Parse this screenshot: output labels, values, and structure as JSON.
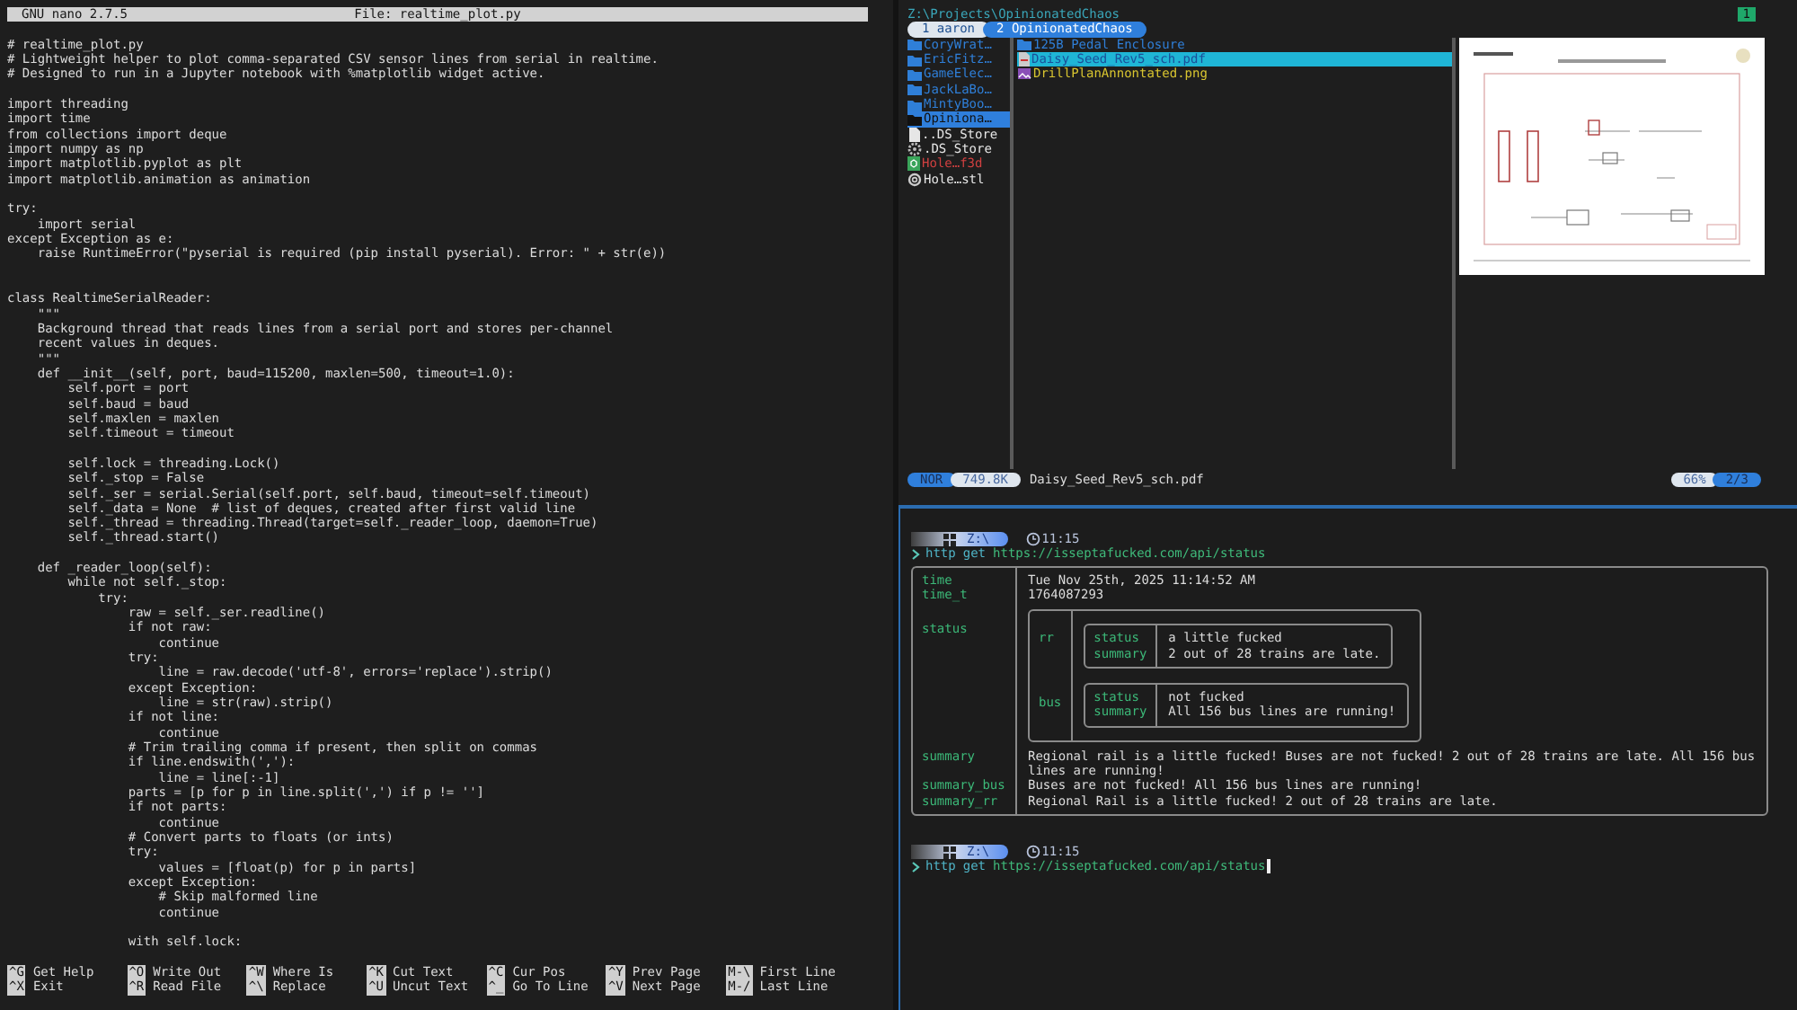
{
  "nano": {
    "version": "GNU nano 2.7.5",
    "file": "File: realtime_plot.py",
    "lines": [
      {
        "kind": "code",
        "text": "# realtime_plot.py"
      },
      {
        "kind": "code",
        "text": "# Lightweight helper to plot comma-separated CSV sensor lines from serial in realtime."
      },
      {
        "kind": "code",
        "text": "# Designed to run in a Jupyter notebook with %matplotlib widget active."
      },
      {
        "kind": "blank"
      },
      {
        "kind": "code",
        "text": "import threading"
      },
      {
        "kind": "code",
        "text": "import time"
      },
      {
        "kind": "code",
        "text": "from collections import deque"
      },
      {
        "kind": "code",
        "text": "import numpy as np"
      },
      {
        "kind": "code",
        "text": "import matplotlib.pyplot as plt"
      },
      {
        "kind": "code",
        "text": "import matplotlib.animation as animation"
      },
      {
        "kind": "blank"
      },
      {
        "kind": "code",
        "text": "try:"
      },
      {
        "kind": "code",
        "text": "    import serial"
      },
      {
        "kind": "code",
        "text": "except Exception as e:"
      },
      {
        "kind": "code",
        "text": "    raise RuntimeError(\"pyserial is required (pip install pyserial). Error: \" + str(e))"
      },
      {
        "kind": "blank"
      },
      {
        "kind": "blank"
      },
      {
        "kind": "code",
        "text": "class RealtimeSerialReader:"
      },
      {
        "kind": "code",
        "text": "    \"\"\""
      },
      {
        "kind": "code",
        "text": "    Background thread that reads lines from a serial port and stores per-channel"
      },
      {
        "kind": "code",
        "text": "    recent values in deques."
      },
      {
        "kind": "code",
        "text": "    \"\"\""
      },
      {
        "kind": "code",
        "text": "    def __init__(self, port, baud=115200, maxlen=500, timeout=1.0):"
      },
      {
        "kind": "code",
        "text": "        self.port = port"
      },
      {
        "kind": "code",
        "text": "        self.baud = baud"
      },
      {
        "kind": "code",
        "text": "        self.maxlen = maxlen"
      },
      {
        "kind": "code",
        "text": "        self.timeout = timeout"
      },
      {
        "kind": "blank"
      },
      {
        "kind": "code",
        "text": "        self.lock = threading.Lock()"
      },
      {
        "kind": "code",
        "text": "        self._stop = False"
      },
      {
        "kind": "code",
        "text": "        self._ser = serial.Serial(self.port, self.baud, timeout=self.timeout)"
      },
      {
        "kind": "code",
        "text": "        self._data = None  # list of deques, created after first valid line"
      },
      {
        "kind": "code",
        "text": "        self._thread = threading.Thread(target=self._reader_loop, daemon=True)"
      },
      {
        "kind": "code",
        "text": "        self._thread.start()"
      },
      {
        "kind": "blank"
      },
      {
        "kind": "code",
        "text": "    def _reader_loop(self):"
      },
      {
        "kind": "code",
        "text": "        while not self._stop:"
      },
      {
        "kind": "code",
        "text": "            try:"
      },
      {
        "kind": "code",
        "text": "                raw = self._ser.readline()"
      },
      {
        "kind": "code",
        "text": "                if not raw:"
      },
      {
        "kind": "code",
        "text": "                    continue"
      },
      {
        "kind": "code",
        "text": "                try:"
      },
      {
        "kind": "code",
        "text": "                    line = raw.decode('utf-8', errors='replace').strip()"
      },
      {
        "kind": "code",
        "text": "                except Exception:"
      },
      {
        "kind": "code",
        "text": "                    line = str(raw).strip()"
      },
      {
        "kind": "code",
        "text": "                if not line:"
      },
      {
        "kind": "code",
        "text": "                    continue"
      },
      {
        "kind": "code",
        "text": "                # Trim trailing comma if present, then split on commas"
      },
      {
        "kind": "code",
        "text": "                if line.endswith(','):"
      },
      {
        "kind": "code",
        "text": "                    line = line[:-1]"
      },
      {
        "kind": "code",
        "text": "                parts = [p for p in line.split(',') if p != '']"
      },
      {
        "kind": "code",
        "text": "                if not parts:"
      },
      {
        "kind": "code",
        "text": "                    continue"
      },
      {
        "kind": "code",
        "text": "                # Convert parts to floats (or ints)"
      },
      {
        "kind": "code",
        "text": "                try:"
      },
      {
        "kind": "code",
        "text": "                    values = [float(p) for p in parts]"
      },
      {
        "kind": "code",
        "text": "                except Exception:"
      },
      {
        "kind": "code",
        "text": "                    # Skip malformed line"
      },
      {
        "kind": "code",
        "text": "                    continue"
      },
      {
        "kind": "blank"
      },
      {
        "kind": "code",
        "text": "                with self.lock:"
      }
    ],
    "shortcuts": [
      {
        "key": "^G",
        "label": "Get Help"
      },
      {
        "key": "^X",
        "label": "Exit"
      },
      {
        "key": "^O",
        "label": "Write Out"
      },
      {
        "key": "^R",
        "label": "Read File"
      },
      {
        "key": "^W",
        "label": "Where Is"
      },
      {
        "key": "^\\",
        "label": "Replace"
      },
      {
        "key": "^K",
        "label": "Cut Text"
      },
      {
        "key": "^U",
        "label": "Uncut Text"
      },
      {
        "key": "^C",
        "label": "Cur Pos"
      },
      {
        "key": "^_",
        "label": "Go To Line"
      },
      {
        "key": "^Y",
        "label": "Prev Page"
      },
      {
        "key": "^V",
        "label": "Next Page"
      },
      {
        "key": "M-\\",
        "label": "First Line"
      },
      {
        "key": "M-/",
        "label": "Last Line"
      }
    ]
  },
  "file_manager": {
    "path": "Z:\\Projects\\OpinionatedChaos",
    "badge": "1",
    "tabs": [
      {
        "label": "1 aaron",
        "selected": false
      },
      {
        "label": "2 OpinionatedChaos",
        "selected": true
      }
    ],
    "parent_items": [
      {
        "name": "CoryWrat…",
        "kind": "folder",
        "color": "#2f7fd8",
        "selected": false
      },
      {
        "name": "EricFitz…",
        "kind": "folder",
        "color": "#2f7fd8",
        "selected": false
      },
      {
        "name": "GameElec…",
        "kind": "folder",
        "color": "#2f7fd8",
        "selected": false
      },
      {
        "name": "JackLaBo…",
        "kind": "folder",
        "color": "#2f7fd8",
        "selected": false
      },
      {
        "name": "MintyBoo…",
        "kind": "folder",
        "color": "#2f7fd8",
        "selected": false
      },
      {
        "name": "Opiniona…",
        "kind": "folder",
        "selected": true
      },
      {
        "name": "..DS_Store",
        "kind": "file",
        "color": "#e6e6e6",
        "selected": false
      },
      {
        "name": ".DS_Store",
        "kind": "config",
        "color": "#e6e6e6",
        "selected": false
      },
      {
        "name": "Hole…f3d",
        "kind": "model",
        "color": "#d04040",
        "selected": false
      },
      {
        "name": "Hole…stl",
        "kind": "mesh",
        "color": "#e6e6e6",
        "selected": false
      }
    ],
    "items": [
      {
        "name": "125B Pedal Enclosure",
        "kind": "folder",
        "color": "#2f7fd8",
        "selected": false
      },
      {
        "name": "Daisy_Seed_Rev5_sch.pdf",
        "kind": "pdf",
        "selected": true
      },
      {
        "name": "DrillPlanAnnontated.png",
        "kind": "image",
        "color": "#d8c530",
        "selected": false
      }
    ],
    "status_bar": {
      "mode": "NOR",
      "size": "749.8K",
      "filename": "Daisy_Seed_Rev5_sch.pdf",
      "percent": "66%",
      "position": "2/3"
    }
  },
  "terminal": {
    "blocks": [
      {
        "dir": "Z:\\",
        "time": "11:15",
        "command": "http",
        "argument": "get",
        "url": "https://isseptafucked.com/api/status",
        "cursor": false,
        "output": [
          {
            "key": "time",
            "value": "Tue Nov 25th, 2025 11:14:52 AM"
          },
          {
            "key": "time_t",
            "value": "1764087293"
          },
          {
            "key": "status",
            "table": [
              {
                "key": "rr",
                "table": [
                  {
                    "key": "status",
                    "value": "a little fucked"
                  },
                  {
                    "key": "summary",
                    "value": "2 out of 28 trains are late."
                  }
                ]
              },
              {
                "key": "bus",
                "table": [
                  {
                    "key": "status",
                    "value": "not fucked"
                  },
                  {
                    "key": "summary",
                    "value": "All 156 bus lines are running!"
                  }
                ]
              }
            ]
          },
          {
            "key": "summary",
            "value": "Regional rail is a little fucked! Buses are not fucked! 2 out of 28 trains are late. All 156 bus lines are running!"
          },
          {
            "key": "summary_bus",
            "value": "Buses are not fucked! All 156 bus lines are running!"
          },
          {
            "key": "summary_rr",
            "value": "Regional Rail is a little fucked! 2 out of 28 trains are late."
          }
        ]
      },
      {
        "dir": "Z:\\",
        "time": "11:15",
        "command": "http",
        "argument": "get",
        "url": "https://isseptafucked.com/api/status",
        "cursor": true
      }
    ]
  }
}
